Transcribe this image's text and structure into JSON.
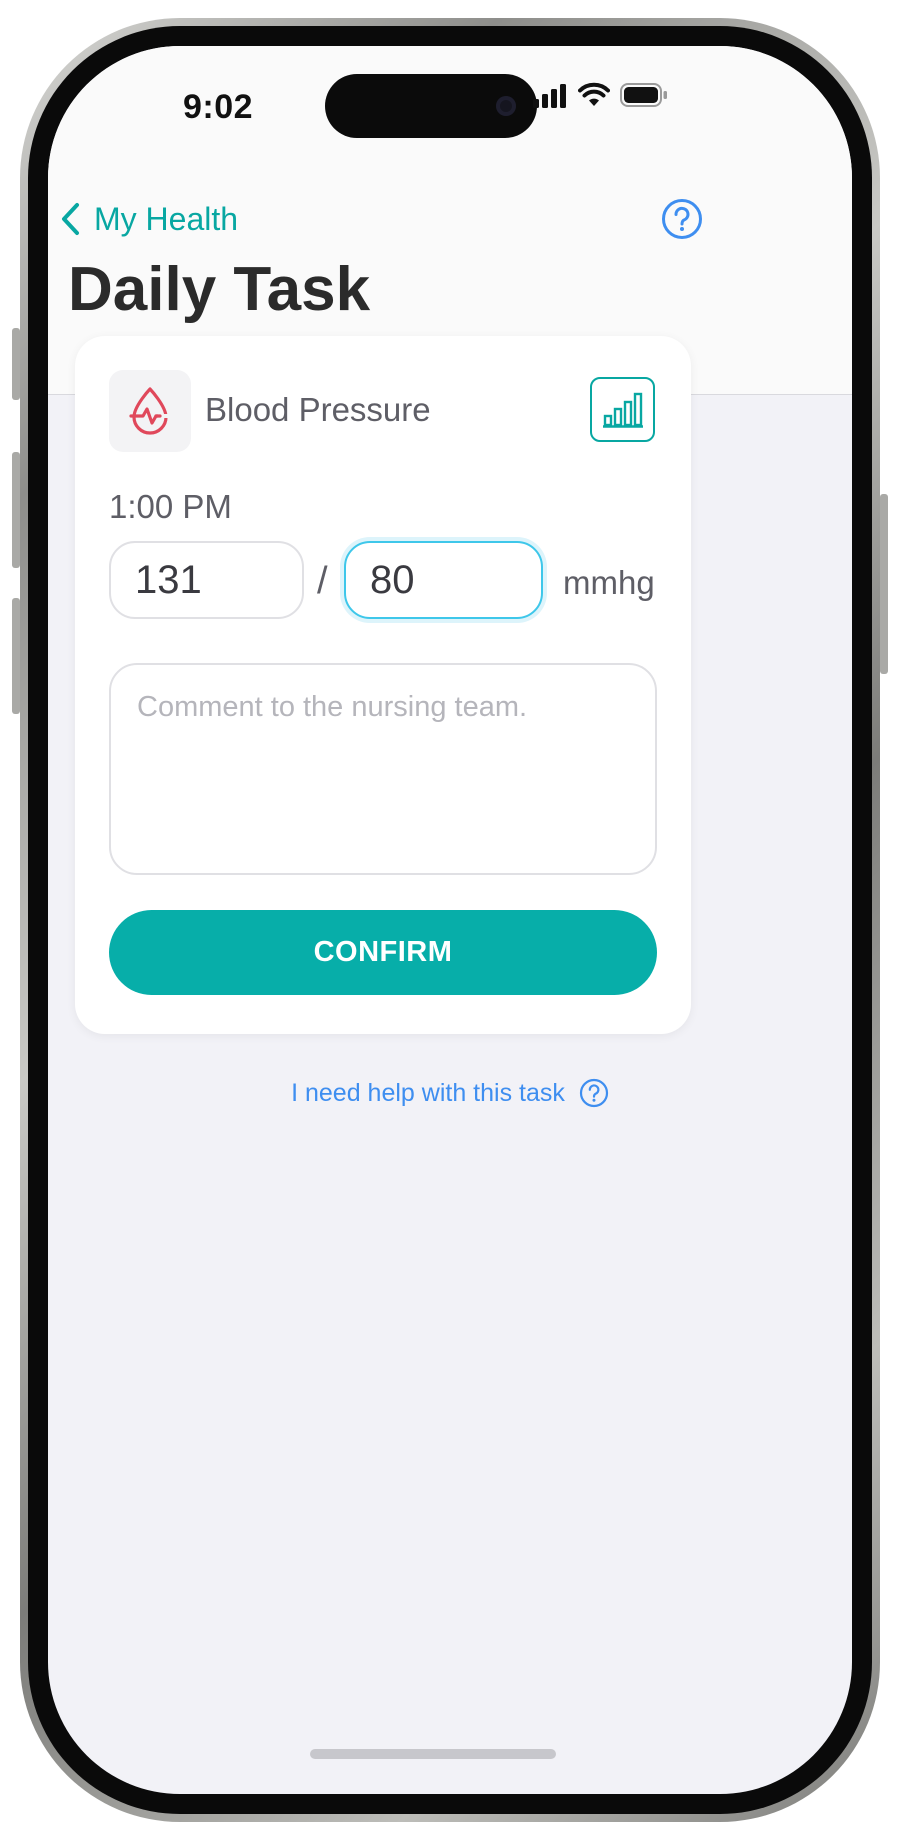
{
  "status_bar": {
    "time": "9:02",
    "icons": [
      "cellular-signal-icon",
      "wifi-icon",
      "battery-icon"
    ]
  },
  "nav": {
    "back_label": "My Health",
    "back_icon": "chevron-left-icon",
    "help_icon": "question-circle-icon"
  },
  "page": {
    "title": "Daily Task"
  },
  "task": {
    "icon": "blood-drop-pulse-icon",
    "name": "Blood Pressure",
    "chart_icon": "bar-chart-icon",
    "time": "1:00 PM",
    "systolic": "131",
    "separator": "/",
    "diastolic": "80",
    "unit": "mmhg",
    "comment_placeholder": "Comment to the nursing team.",
    "comment_value": ""
  },
  "actions": {
    "confirm_label": "CONFIRM",
    "help_link": "I need help with this task",
    "help_link_icon": "question-circle-icon"
  },
  "colors": {
    "accent": "#07aea9",
    "link": "#3e8ef0",
    "danger_icon": "#e0485b",
    "focus_border": "#3ec7ea",
    "background": "#f2f2f7"
  }
}
